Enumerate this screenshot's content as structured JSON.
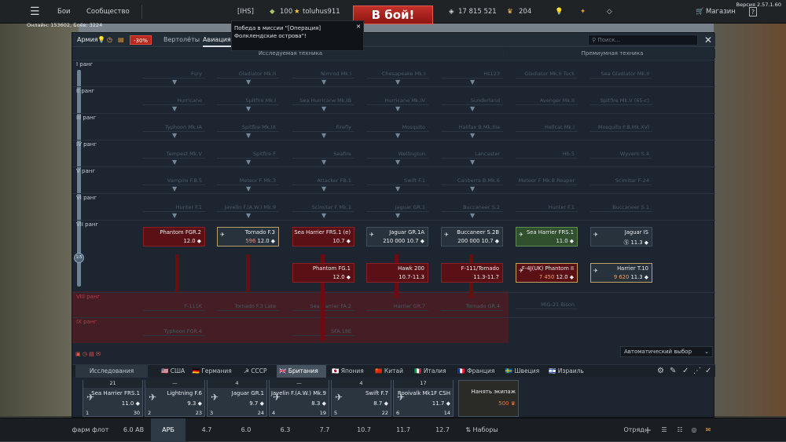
{
  "topbar": {
    "menu": "menu-icon",
    "battles": "Бои",
    "community": "Сообщество",
    "squad_tag": "[IHS]",
    "currency_amount": "100",
    "username": "toluhus911",
    "battle_button": "В бой!",
    "silver_lions": "17 815 521",
    "golden_eagles": "204",
    "shop": "Магазин",
    "help": "?",
    "version": "Версия 2.57.1.60"
  },
  "online": "Онлайн: 153602, Боёв: 3224",
  "notification": {
    "text": "Победа в миссии \"[Операция] Фолклендские острова\"!"
  },
  "tree": {
    "tabs": {
      "army": "Армия",
      "discount": "-30%",
      "helicopters": "Вертолёты",
      "aviation": "Авиация"
    },
    "search_placeholder": "Поиск...",
    "sections": {
      "researched": "Исследуемая техника",
      "premium": "Премиумная техника"
    },
    "ranks": [
      "I ранг",
      "II ранг",
      "III ранг",
      "IV ранг",
      "V ранг",
      "VI ранг",
      "VII ранг",
      "VIII ранг",
      "IX ранг"
    ],
    "ghosts": {
      "r1": [
        "Fury",
        "Gladiator Mk.II",
        "Nimrod Mk.I",
        "Chesapeake Mk.I",
        "Hs123"
      ],
      "r2": [
        "Hurricane",
        "Spitfire Mk.I",
        "Sea Hurricane Mk.IB",
        "Hurricane Mk.IV",
        "Sunderland"
      ],
      "r3": [
        "Typhoon Mk.IA",
        "Spitfire Mk.IX",
        "Firefly",
        "Mosquito",
        "Halifax B.Mk.IIIa"
      ],
      "r4": [
        "Tempest Mk.V",
        "Spitfire F",
        "Seafire",
        "Wellington",
        "Lancaster"
      ],
      "r5": [
        "Vampire F.B.5",
        "Meteor F Mk.3",
        "Attacker FB.1",
        "Swift F.1",
        "Canberra B.Mk.6"
      ],
      "r6": [
        "Hunter F.1",
        "Javelin F.(A.W.) Mk.9",
        "Scimitar F Mk.1",
        "Jaguar GR.1",
        "Buccaneer S.2"
      ],
      "r8": [
        "F-111K",
        "Tornado F.3 Late",
        "Sea Harrier FA.2",
        "Harrier GR.7",
        "Tornado GR.4"
      ],
      "r9": [
        "Typhoon FGR.4",
        "",
        "SFA.18E"
      ],
      "prem": [
        "Gladiator Mk.II Tuck",
        "Sea Gladiator Mk.II",
        "Avenger Mk.II",
        "Spitfire Mk.V (65-c)",
        "Hellcat Mk.I",
        "Mosquito F.B.Mk.XVI",
        "Hb.5",
        "Wyvern S.4",
        "Meteor F Mk.8 Reaper",
        "Scimitar F-24",
        "Hunter F.1",
        "Buccaneer S.1",
        "MiG-21 Bison"
      ]
    },
    "vehicles": [
      {
        "name": "Phantom FGR.2",
        "value": "12.0"
      },
      {
        "name": "Tornado F.3",
        "value": "12.0",
        "cost": "596"
      },
      {
        "name": "Sea Harrier FRS.1 (e)",
        "value": "10.7"
      },
      {
        "name": "Jaguar GR.1A",
        "value": "10.7",
        "cost": "210 000"
      },
      {
        "name": "Buccaneer S.2B",
        "value": "10.7",
        "cost": "200 000"
      },
      {
        "name": "Sea Harrier FRS.1",
        "value": "11.0"
      },
      {
        "name": "Jaguar IS",
        "value": "11.3"
      },
      {
        "name": "Phantom FG.1",
        "value": "12.0"
      },
      {
        "name": "Hawk 200",
        "value": "10.7-11.3"
      },
      {
        "name": "F-111/Tornado",
        "value": "11.3-11.7"
      },
      {
        "name": "F-4J(UK) Phantom II",
        "value": "12.0",
        "cost": "7 450"
      },
      {
        "name": "Harrier T.10",
        "value": "11.3",
        "cost": "9 620"
      }
    ],
    "auto_select": "Автоматический выбор"
  },
  "nations": {
    "research": "Исследования",
    "items": [
      "США",
      "Германия",
      "СССР",
      "Британия",
      "Япония",
      "Китай",
      "Италия",
      "Франция",
      "Швеция",
      "Израиль"
    ],
    "active": "Британия",
    "discount": "-30%"
  },
  "crew": [
    {
      "top": "21",
      "name": "Sea Harrier FRS.1",
      "value": "11.0",
      "slot": "1",
      "count": "30"
    },
    {
      "top": "—",
      "name": "Lightning F.6",
      "value": "9.3",
      "slot": "2",
      "count": "23"
    },
    {
      "top": "4",
      "name": "Jaguar GR.1",
      "value": "9.7",
      "slot": "3",
      "count": "24"
    },
    {
      "top": "—",
      "name": "Javelin F.(A.W.) Mk.9",
      "value": "8.3",
      "slot": "4",
      "count": "19"
    },
    {
      "top": "4",
      "name": "Swift F.7",
      "value": "8.7",
      "slot": "5",
      "count": "22"
    },
    {
      "top": "17",
      "name": "Rooivalk Mk1F CSH",
      "value": "11.7",
      "slot": "6",
      "count": "14"
    }
  ],
  "hire": {
    "label": "Нанять экипаж",
    "cost": "500"
  },
  "bottombar": {
    "farm": "фарм флот",
    "br_main": "6.0 АВ",
    "mode": "АРБ",
    "brs": [
      "4.7",
      "6.0",
      "6.3",
      "7.7",
      "10.7",
      "11.7",
      "12.7"
    ],
    "sets": "Наборы",
    "squad": "Отряд:"
  }
}
